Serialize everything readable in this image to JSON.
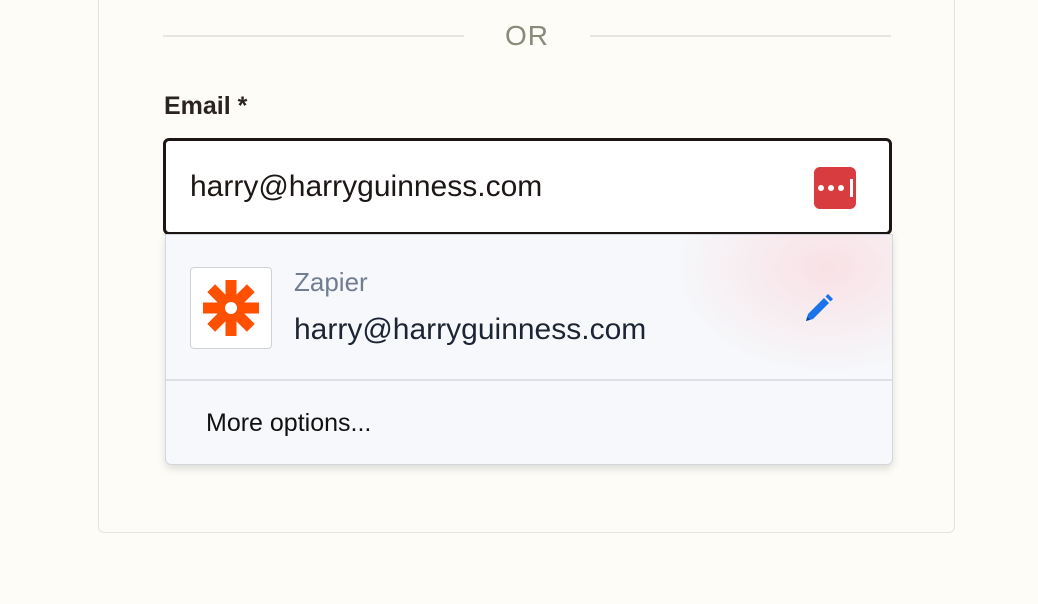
{
  "divider": {
    "text": "OR"
  },
  "email_field": {
    "label": "Email *",
    "value": "harry@harryguinness.com"
  },
  "autofill": {
    "suggestions": [
      {
        "site": "Zapier",
        "username": "harry@harryguinness.com",
        "icon": "zapier-logo"
      }
    ],
    "more_options_label": "More options..."
  },
  "colors": {
    "lastpass_red": "#d83c3e",
    "zapier_orange": "#ff4f00",
    "edit_blue": "#1a73e8"
  }
}
